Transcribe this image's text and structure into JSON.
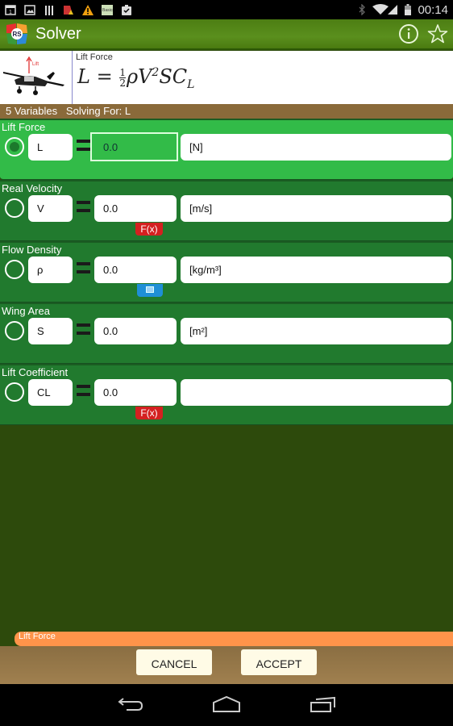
{
  "status_bar": {
    "time": "00:14",
    "left_icons": [
      "calendar-icon",
      "image-icon",
      "barcode-icon",
      "antivirus-icon",
      "warning-icon",
      "basics-app-icon",
      "clipboard-check-icon"
    ],
    "right_icons": [
      "bluetooth-icon",
      "wifi-icon",
      "signal-icon",
      "battery-icon"
    ]
  },
  "action_bar": {
    "app_logo_text": "RS",
    "title": "Solver",
    "actions": [
      "info-icon",
      "star-icon"
    ]
  },
  "formula": {
    "name": "Lift Force",
    "lhs": "L",
    "equals": "=",
    "numerator": "1",
    "denominator": "2",
    "rhs": "ρV",
    "exponent": "2",
    "rhs2": "SC",
    "subscript": "L",
    "image_label": "Lift"
  },
  "info_bar": {
    "variables": "5 Variables",
    "solving_for": "Solving For: L"
  },
  "variables": [
    {
      "label": "Lift Force",
      "symbol": "L",
      "value": "0.0",
      "unit": "[N]",
      "selected": true,
      "helper": ""
    },
    {
      "label": "Real Velocity",
      "symbol": "V",
      "value": "0.0",
      "unit": "[m/s]",
      "selected": false,
      "helper": "F(x)"
    },
    {
      "label": "Flow Density",
      "symbol": "ρ",
      "value": "0.0",
      "unit": "[kg/m³]",
      "selected": false,
      "helper": "keyboard"
    },
    {
      "label": "Wing Area",
      "symbol": "S",
      "value": "0.0",
      "unit": "[m²]",
      "selected": false,
      "helper": ""
    },
    {
      "label": "Lift Coefficient",
      "symbol": "CL",
      "value": "0.0",
      "unit": "",
      "selected": false,
      "helper": "F(x)"
    }
  ],
  "bottom": {
    "tag": "Lift Force",
    "cancel_label": "CANCEL",
    "accept_label": "ACCEPT"
  },
  "colors": {
    "action_bar": "#5a8f1d",
    "active_row": "#32bb48",
    "row": "#217a2e",
    "fx_button": "#d42020",
    "keyboard_button": "#1f8fd6",
    "orange_tag": "#ff944a",
    "button_bar": "#967548"
  }
}
